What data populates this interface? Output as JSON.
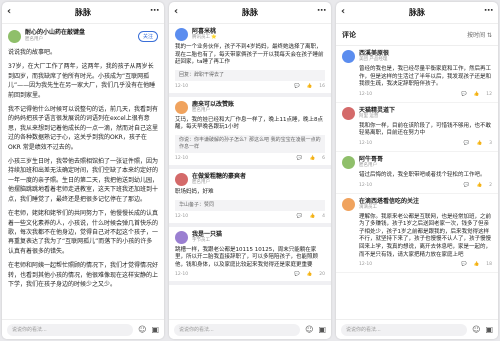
{
  "panel1": {
    "title": "脉脉",
    "author_name": "耐心的小山药在敲键盘",
    "author_sub": "匿名用户",
    "follow": "关注",
    "paragraphs": [
      "说说我的故事吧。",
      "37岁，在大厂工作了两年，这两年，我的孩子从两岁长到四岁，而我缺席了他所有时光。小孩成为“互联网孤儿”——因为我先生在另一家大厂，我们几乎没有在他睡前回到家里。",
      "我不记得他什么时候可以说整句的话，前几天，我看到有的妈妈把孩子语言很发展说的词语列在excel上很有意思，我从来想到记着他成长的一点一滴，然而对自己这里过的各种数据熟记于心，这关乎到我的OKR，孩子在OKR 常是绩效不过去的。",
      "小孩三岁生日时，我带他去照相馆拍了一张证件照，因为持续加班和出差无法确定时间，我们空缺了本来约定好的一年一度的亲子照。生日的第二天，我把他送到幼儿园，他摆脑跳跳地看着老师走进教室，这天下班我还加班到十点，我们睡觉了，最终还是把很多记忆停在了那边。",
      "在老师，姥姥和姥爷们的共同努力下，他慢慢长成的认真着一些文化素养的人，小孩说，什么时候会弹几首快乐的歌，每次我都不在他身边，觉得自己对不起这个孩子，一再重复表达了我为了“互联网孤儿”而落下的小孩的许多认真有着很多的错失。",
      "在老师和阿姨一起帮忙照顾的情况下，我们才觉得情况好转，也看到其他小孩的情况，他很难像现在这样安静的上下学，我们在孩子身边的时候少之又少。"
    ],
    "input_placeholder": "说说你的看法..."
  },
  "panel2": {
    "title": "脉脉",
    "cards": [
      {
        "name": "阿喜米桃",
        "meta": "腾讯员工 ⭐",
        "text": "我的一个业务伙伴，孩子不到4岁妈妈，最终她选择了离职，现在二胎也有了，每天带家俩孩子一开以我每天会在孩子睡前赶回家，ta睡了再工作",
        "quote": "回复：辞职干得去了",
        "time": "12-10",
        "likes": "16"
      },
      {
        "name": "鹿来可以改赞账",
        "meta": "匿名用户",
        "text": "艾玛，我的娃已经和大厂作息一样了，晚上11点睡，晚上8点醒，每天早晚各跟玩1小时",
        "quote": "你说：你丰谦破解的孙子怎么？那这么吧 我的宝宝在凌晨一点的作息一样",
        "time": "12-10",
        "likes": "6"
      },
      {
        "name": "在做爱粗糖的豪爽者",
        "meta": "匿名用户",
        "text": "职场妈妈，好难",
        "quote": "华山备子：赞同",
        "time": "12-10",
        "likes": "4"
      },
      {
        "name": "我是一只猫",
        "meta": "字节员工",
        "text": "跳槽一样，我跟老公都是10115 10125，周末只能躺在家里，所以开二胎我直接辞职了，可以多陪陪孩子，也能照顾他，钱和身体，以及家庭比较起来我觉得还是家庭更重要",
        "quote": "",
        "time": "12-10",
        "likes": "20"
      }
    ],
    "input_placeholder": "说说你的看法..."
  },
  "panel3": {
    "title": "脉脉",
    "section_label": "评论",
    "sort_label": "按时间 ⇅",
    "comments": [
      {
        "name": "西溪美原很",
        "meta": "美团 产品经理",
        "text": "曾经的我也是，我已经尽量平衡家庭和工作，然后再工作，但是这样的生活过了半年以后，我发现孩子还是和我很生疏，我决定辞职陪伴孩子。",
        "time": "12-10",
        "likes": "12"
      },
      {
        "name": "天猫精灵道下",
        "meta": "阿里 运营",
        "text": "我和你一样，目前在该阶段了，可惜钱不够用，也不敢轻易离职，目前还在努力中",
        "time": "12-10",
        "likes": "3"
      },
      {
        "name": "阿牛哥哥",
        "meta": "匿名用户",
        "text": "错过后悔的说，我全职带吧或者找个轻松的工作吧。",
        "time": "12-10",
        "likes": "2"
      },
      {
        "name": "在滴西塔看信吃的关注",
        "meta": "滴滴员工",
        "text": "理解你。我原来老公都是互联网，也是经常加班，之前为了多赚钱，孩子1岁之后送回老家一次，钱多了但亲子相处少，孩子1岁之前都是跟我的，后来我觉得这样不行，就坚持下来了，孩子也慢慢不认人了，孩子慢慢回来上学，我真的想说，离开去休息吧，家是一起的，而不是只有钱，请大家把精力放在家庭上吧",
        "time": "12-10",
        "likes": "18"
      }
    ],
    "input_placeholder": "说说你的看法..."
  },
  "colors": {
    "accent": "#3a6fd8",
    "av1": "#8fbf6a",
    "av2": "#5b8def",
    "av3": "#f0a35e",
    "av4": "#d46a6a",
    "av5": "#9a7fd1"
  },
  "icons": {
    "back": "chevron-left-icon",
    "more": "more-icon",
    "like": "thumb-up-icon",
    "comment": "comment-icon",
    "share": "share-icon",
    "emoji": "emoji-icon",
    "image": "image-icon"
  }
}
